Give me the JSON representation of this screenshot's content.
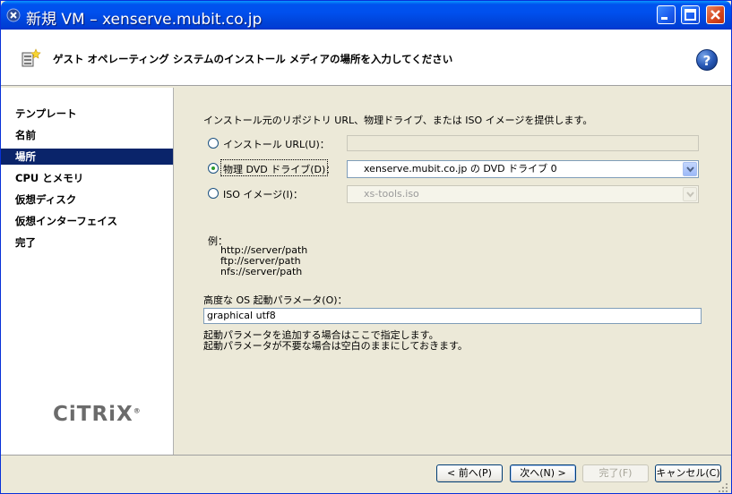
{
  "window": {
    "title": "新規 VM – xenserve.mubit.co.jp"
  },
  "header": {
    "title": "ゲスト オペレーティング システムのインストール メディアの場所を入力してください",
    "help_label": "?"
  },
  "sidebar": {
    "items": [
      {
        "label": "テンプレート",
        "selected": false
      },
      {
        "label": "名前",
        "selected": false
      },
      {
        "label": "場所",
        "selected": true
      },
      {
        "label": "CPU とメモリ",
        "selected": false
      },
      {
        "label": "仮想ディスク",
        "selected": false
      },
      {
        "label": "仮想インターフェイス",
        "selected": false
      },
      {
        "label": "完了",
        "selected": false
      }
    ],
    "logo_text": "CiTRiX",
    "logo_mark": "®"
  },
  "content": {
    "intro": "インストール元のリポジトリ URL、物理ドライブ、または ISO イメージを提供します。",
    "install_url": {
      "label": "インストール URL(U)：",
      "value": "",
      "selected": false
    },
    "dvd_drive": {
      "label": "物理 DVD ドライブ(D)：",
      "value": "xenserve.mubit.co.jp の DVD ドライブ 0",
      "selected": true
    },
    "iso_image": {
      "label": "ISO イメージ(I)：",
      "value": "xs-tools.iso",
      "selected": false
    },
    "example_heading": "例：",
    "examples": [
      "http://server/path",
      "ftp://server/path",
      "nfs://server/path"
    ],
    "boot_params_label": "高度な OS 起動パラメータ(O)：",
    "boot_params_value": "graphical utf8",
    "boot_params_help_1": "起動パラメータを追加する場合はここで指定します。",
    "boot_params_help_2": "起動パラメータが不要な場合は空白のままにしておきます。"
  },
  "footer": {
    "back_label": "< 前へ(P)",
    "next_label": "次へ(N) >",
    "finish_label": "完了(F)",
    "cancel_label": "キャンセル(C)"
  }
}
